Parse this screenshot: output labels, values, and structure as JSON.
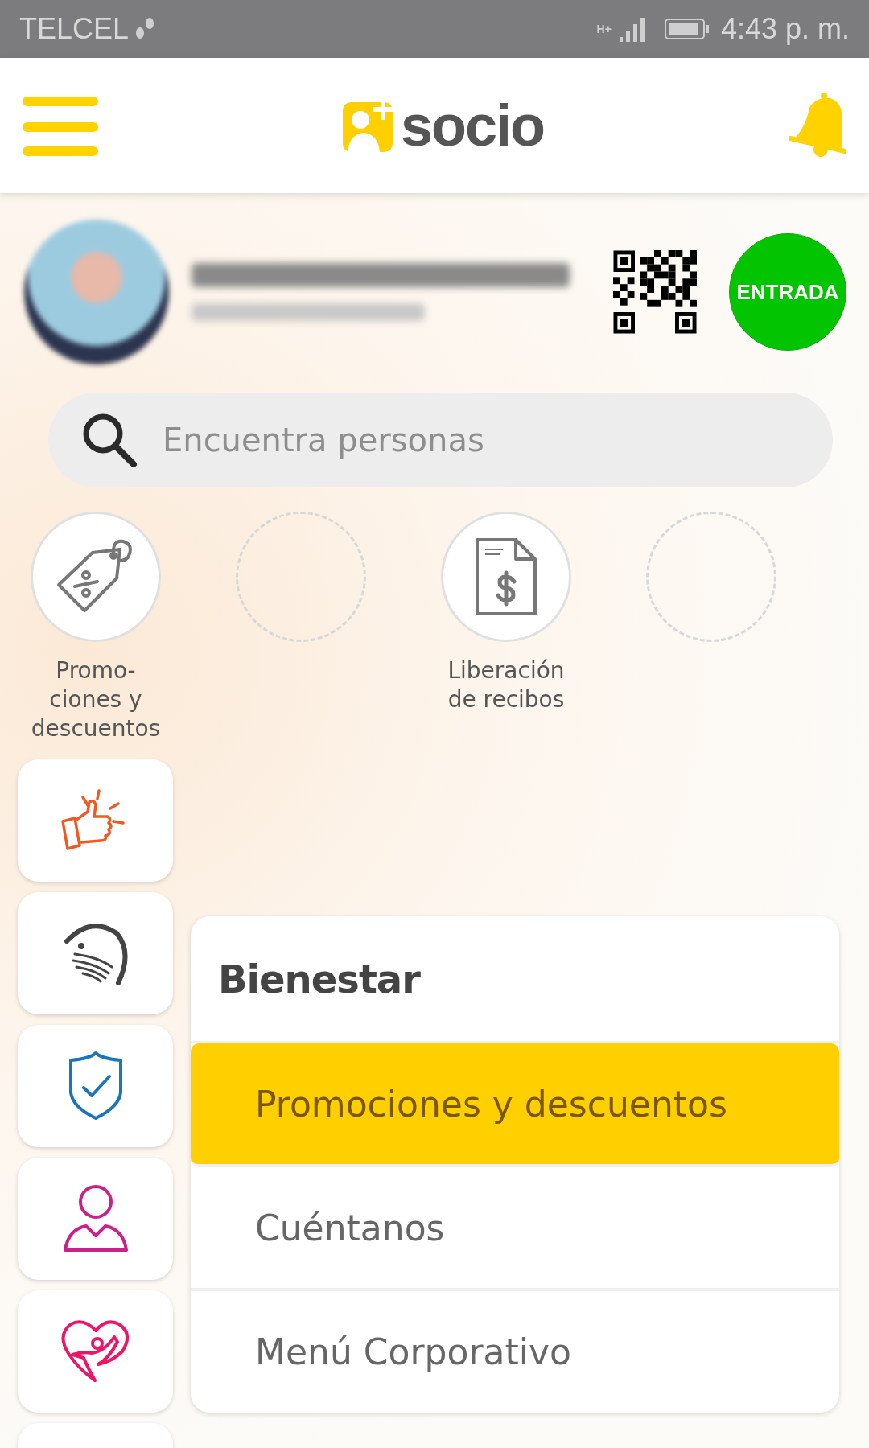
{
  "status_bar": {
    "carrier": "TELCEL",
    "network": "H+",
    "time": "4:43 p. m."
  },
  "header": {
    "logo": "socio"
  },
  "profile": {
    "check_in_button": "ENTRADA"
  },
  "search": {
    "placeholder": "Encuentra personas"
  },
  "shortcuts": [
    {
      "kind": "tag",
      "label": "Promo-\nciones y\ndescuentos"
    },
    {
      "kind": "empty"
    },
    {
      "kind": "document",
      "label": "Liberación\nde recibos"
    },
    {
      "kind": "empty"
    }
  ],
  "sidebar": {
    "items": [
      {
        "kind": "thumbs-up"
      },
      {
        "kind": "face"
      },
      {
        "kind": "shield"
      },
      {
        "kind": "person"
      },
      {
        "kind": "heart"
      }
    ]
  },
  "menu": {
    "title": "Bienestar",
    "items": [
      {
        "label": "Promociones y descuentos",
        "selected": true
      },
      {
        "label": "Cuéntanos",
        "selected": false
      },
      {
        "label": "Menú Corporativo",
        "selected": false
      }
    ]
  }
}
